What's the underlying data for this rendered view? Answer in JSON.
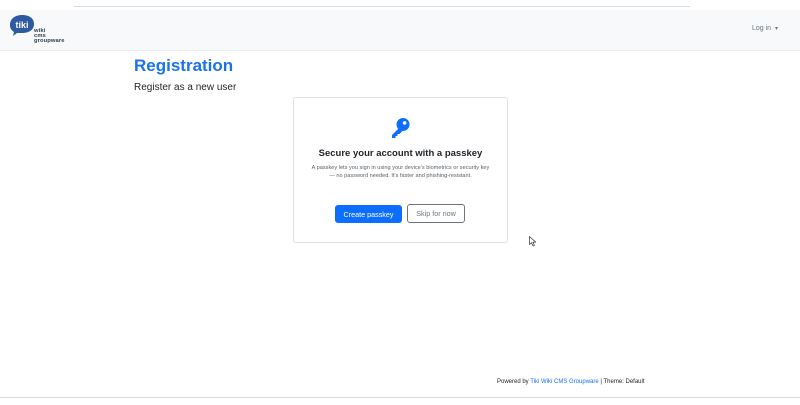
{
  "header": {
    "logo": {
      "line1": "wiki",
      "line2": "cms",
      "line3": "groupware",
      "badge_text": "tiki"
    },
    "login_label": "Log in",
    "login_caret": "▾"
  },
  "page": {
    "title": "Registration",
    "subtitle": "Register as a new user"
  },
  "passkey_card": {
    "icon": "key-icon",
    "heading": "Secure your account with a passkey",
    "description": "A passkey lets you sign in using your device's biometrics or security key — no password needed. It's faster and phishing-resistant.",
    "create_button": "Create passkey",
    "skip_button": "Skip for now"
  },
  "footer": {
    "powered_by": "Powered by",
    "link_text": "Tiki Wiki CMS Groupware",
    "theme": "| Theme: Default"
  },
  "colors": {
    "accent": "#1a73e8",
    "primary_button": "#0d6efd",
    "navbar_bg": "#f8f9fa"
  }
}
